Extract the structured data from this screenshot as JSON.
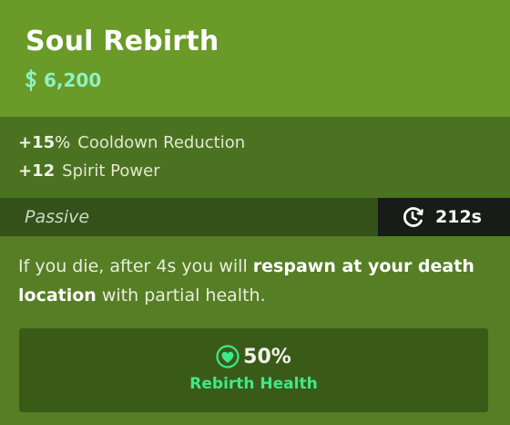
{
  "item": {
    "title": "Soul Rebirth",
    "cost": "6,200",
    "cost_icon": "souls-currency-icon"
  },
  "stats": [
    {
      "value": "+15",
      "unit": "%",
      "label": "Cooldown Reduction"
    },
    {
      "value": "+12",
      "unit": "",
      "label": "Spirit Power"
    }
  ],
  "ability": {
    "type_label": "Passive",
    "cooldown": "212s",
    "cooldown_icon": "cooldown-clock-icon",
    "description_parts": [
      "If you die, after 4s you will ",
      "respawn at your death location",
      " with partial health."
    ]
  },
  "property": {
    "value": "50%",
    "label": "Rebirth Health",
    "icon": "heart-heal-icon"
  },
  "colors": {
    "header_bg": "#6a9a27",
    "stats_bg": "#4b7220",
    "cost_text": "#8ef2c3",
    "property_label": "#3ee88c"
  }
}
